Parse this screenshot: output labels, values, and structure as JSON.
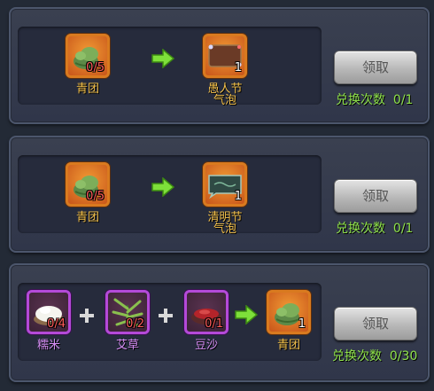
{
  "rows": [
    {
      "inputs": [
        {
          "name": "青团",
          "count": "0/5"
        }
      ],
      "output": {
        "name_line1": "愚人节",
        "name_line2": "气泡",
        "count": "1"
      },
      "button_label": "领取",
      "exchange_label": "兑换次数",
      "exchange_count": "0/1"
    },
    {
      "inputs": [
        {
          "name": "青团",
          "count": "0/5"
        }
      ],
      "output": {
        "name_line1": "清明节",
        "name_line2": "气泡",
        "count": "1"
      },
      "button_label": "领取",
      "exchange_label": "兑换次数",
      "exchange_count": "0/1"
    },
    {
      "inputs": [
        {
          "name": "糯米",
          "count": "0/4"
        },
        {
          "name": "艾草",
          "count": "0/2"
        },
        {
          "name": "豆沙",
          "count": "0/1"
        }
      ],
      "output": {
        "name_line1": "青团",
        "count": "1"
      },
      "button_label": "领取",
      "exchange_label": "兑换次数",
      "exchange_count": "0/30"
    }
  ],
  "colors": {
    "item_name": "#f3c04a",
    "material_name": "#d48cf2",
    "count_text": "#8fe24a",
    "shortage": "#ff5b5b"
  },
  "icons": [
    "qingtuan-icon",
    "fools-day-bubble-icon",
    "qingming-bubble-icon",
    "glutinous-rice-icon",
    "mugwort-icon",
    "bean-paste-icon",
    "arrow-right-icon",
    "plus-icon"
  ]
}
